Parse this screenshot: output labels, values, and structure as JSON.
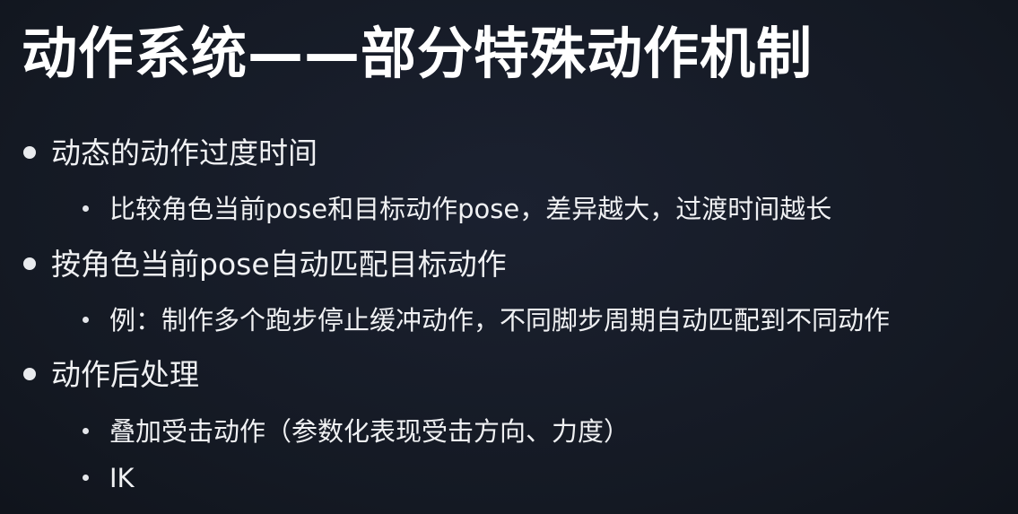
{
  "slide": {
    "title": "动作系统——部分特殊动作机制",
    "items": [
      {
        "text": "动态的动作过度时间"
      },
      {
        "text": "比较角色当前pose和目标动作pose，差异越大，过渡时间越长"
      },
      {
        "text": "按角色当前pose自动匹配目标动作"
      },
      {
        "text": "例：制作多个跑步停止缓冲动作，不同脚步周期自动匹配到不同动作"
      },
      {
        "text": "动作后处理"
      },
      {
        "text": "叠加受击动作（参数化表现受击方向、力度）"
      },
      {
        "text": "IK"
      }
    ]
  },
  "colors": {
    "background": "#151a24",
    "text": "#f0f1f3",
    "title": "#ffffff"
  }
}
